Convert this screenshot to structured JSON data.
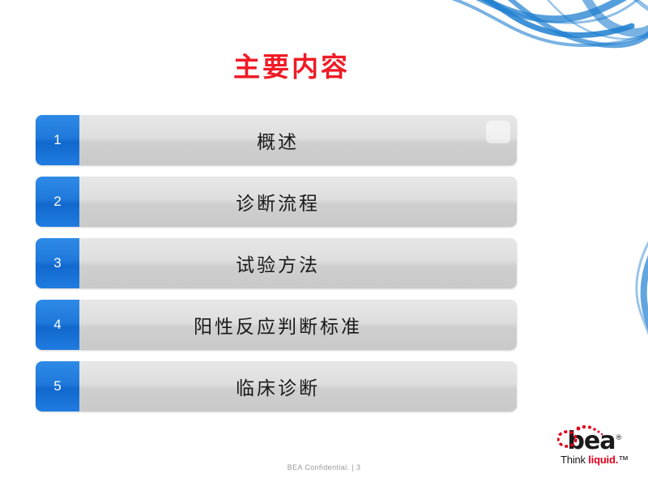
{
  "slide": {
    "title": "主要内容",
    "title_color": "#ef1b26",
    "items": [
      {
        "number": "1",
        "label": "概述"
      },
      {
        "number": "2",
        "label": "诊断流程"
      },
      {
        "number": "3",
        "label": "试验方法"
      },
      {
        "number": "4",
        "label": "阳性反应判断标准"
      },
      {
        "number": "5",
        "label": "临床诊断"
      }
    ],
    "footer": "BEA Confidential.  |   3",
    "logo": {
      "wordmark": "bea",
      "registered": "®",
      "tagline_prefix": "Think ",
      "tagline_accent": "liquid.",
      "tagline_suffix": "™",
      "accent_color": "#e2001a"
    },
    "decor": {
      "smoke_color": "#1f7fd0"
    }
  }
}
